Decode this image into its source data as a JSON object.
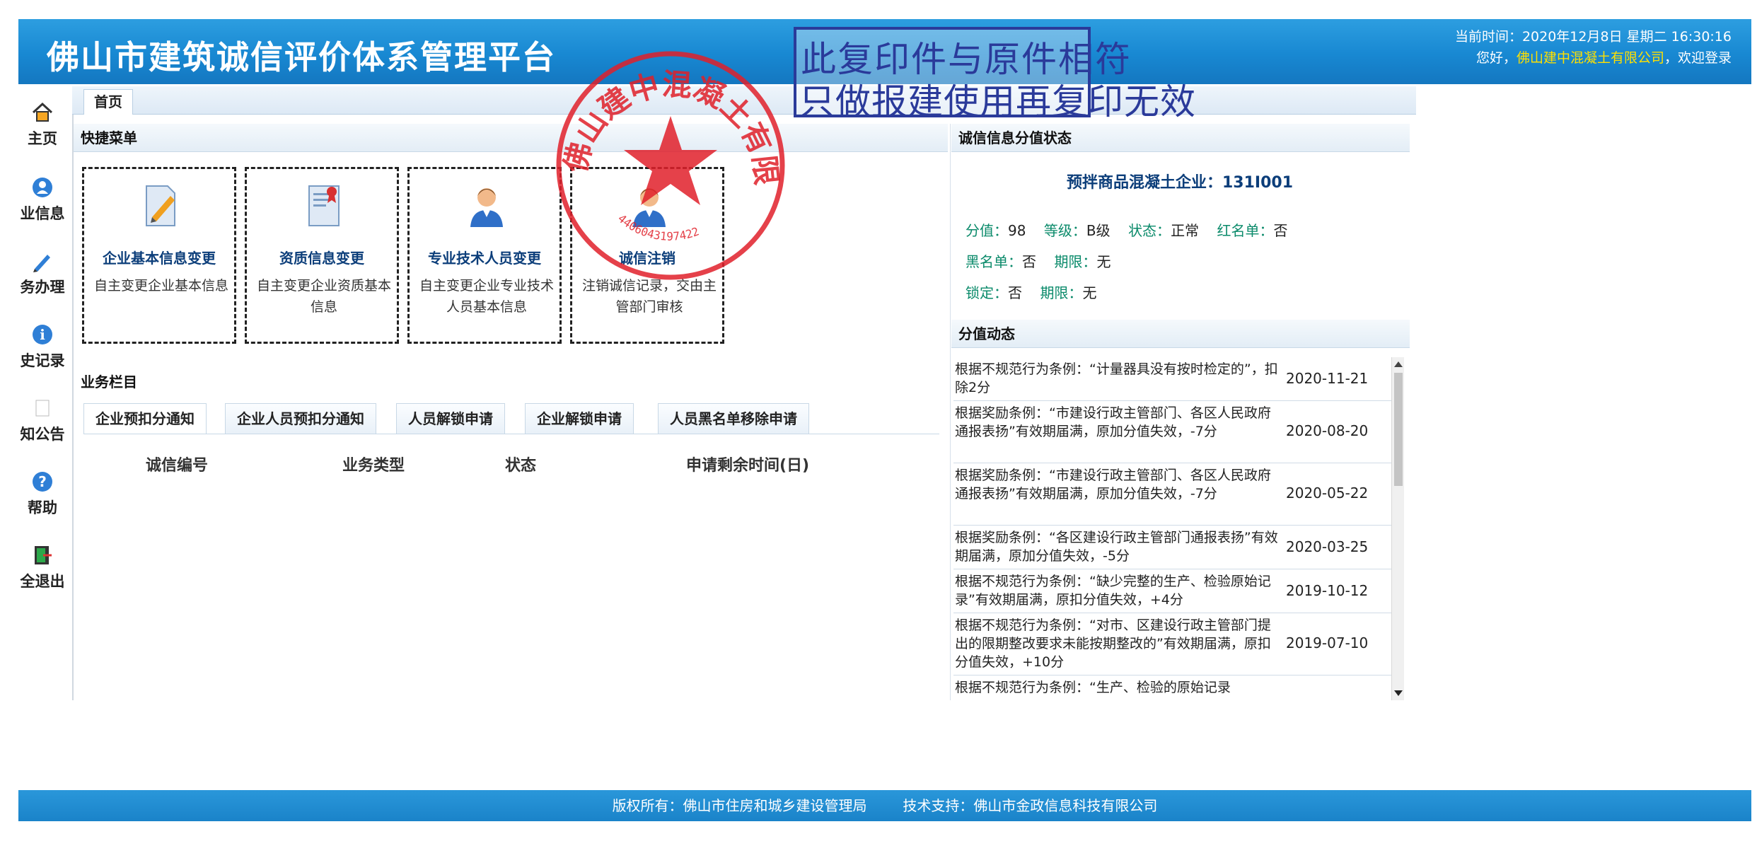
{
  "header": {
    "title": "佛山市建筑诚信评价体系管理平台",
    "time": "当前时间：2020年12月8日 星期二 16:30:16",
    "welcome_prefix": "您好，",
    "company": "佛山建中混凝土有限公司",
    "welcome_suffix": "，欢迎登录"
  },
  "nav": {
    "items": [
      {
        "label": "主页",
        "icon": "home-icon"
      },
      {
        "label": "业信息",
        "icon": "user-info-icon"
      },
      {
        "label": "务办理",
        "icon": "pencil-icon"
      },
      {
        "label": "史记录",
        "icon": "info-icon"
      },
      {
        "label": "知公告",
        "icon": "notice-icon"
      },
      {
        "label": "帮助",
        "icon": "help-icon"
      },
      {
        "label": "全退出",
        "icon": "exit-icon"
      }
    ]
  },
  "tabs": {
    "home": "首页"
  },
  "quick_menu": {
    "title": "快捷菜单",
    "items": [
      {
        "title": "企业基本信息变更",
        "desc": "自主变更企业基本信息",
        "icon": "document-edit-icon"
      },
      {
        "title": "资质信息变更",
        "desc": "自主变更企业资质基本信息",
        "icon": "certificate-icon"
      },
      {
        "title": "专业技术人员变更",
        "desc": "自主变更企业专业技术人员基本信息",
        "icon": "person-icon"
      },
      {
        "title": "诚信注销",
        "desc": "注销诚信记录，交由主管部门审核",
        "icon": "person-icon"
      }
    ]
  },
  "business": {
    "title": "业务栏目",
    "tabs": [
      "企业预扣分通知",
      "企业人员预扣分通知",
      "人员解锁申请",
      "企业解锁申请",
      "人员黑名单移除申请"
    ],
    "columns": [
      "诚信编号",
      "业务类型",
      "状态",
      "申请剩余时间(日)"
    ]
  },
  "credit": {
    "title": "诚信信息分值状态",
    "company_line": "预拌商品混凝土企业：131I001",
    "score_label": "分值：",
    "score": "98",
    "level_label": "等级：",
    "level": "B级",
    "status_label": "状态：",
    "status": "正常",
    "redlist_label": "红名单：",
    "redlist": "否",
    "blacklist_label": "黑名单：",
    "blacklist": "否",
    "term1_label": "期限：",
    "term1": "无",
    "lock_label": "锁定：",
    "lock": "否",
    "term2_label": "期限：",
    "term2": "无"
  },
  "dynamics": {
    "title": "分值动态",
    "items": [
      {
        "text": "根据不规范行为条例：“计量器具没有按时检定的”，扣除2分",
        "date": "2020-11-21"
      },
      {
        "text": "根据奖励条例：“市建设行政主管部门、各区人民政府通报表扬”有效期届满，原加分值失效，-7分",
        "date": "2020-08-20"
      },
      {
        "text": "根据奖励条例：“市建设行政主管部门、各区人民政府通报表扬”有效期届满，原加分值失效，-7分",
        "date": "2020-05-22"
      },
      {
        "text": "根据奖励条例：“各区建设行政主管部门通报表扬”有效期届满，原加分值失效，-5分",
        "date": "2020-03-25"
      },
      {
        "text": "根据不规范行为条例：“缺少完整的生产、检验原始记录”有效期届满，原扣分值失效，+4分",
        "date": "2019-10-12"
      },
      {
        "text": "根据不规范行为条例：“对市、区建设行政主管部门提出的限期整改要求未能按期整改的”有效期届满，原扣分值失效，+10分",
        "date": "2019-07-10"
      },
      {
        "text": "根据不规范行为条例：“生产、检验的原始记录",
        "date": ""
      }
    ]
  },
  "footer": {
    "copyright": "版权所有：佛山市住房和城乡建设管理局",
    "support": "技术支持：佛山市金政信息科技有限公司"
  },
  "stamps": {
    "copy_line1": "此复印件与原件相符",
    "copy_line2": "只做报建使用再复印无效",
    "seal_text": "佛山建中混凝土有限公司",
    "seal_number": "4406043197422"
  }
}
